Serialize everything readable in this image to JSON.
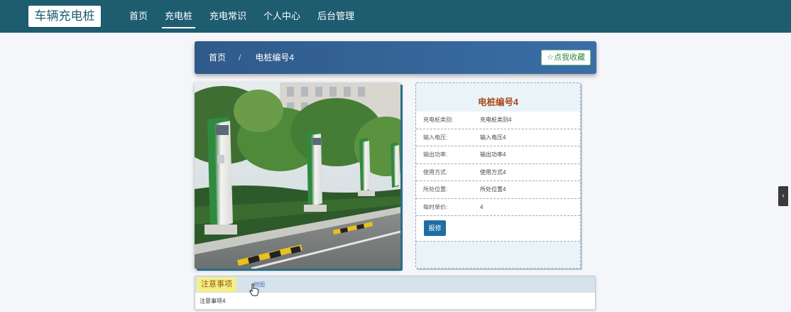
{
  "navbar": {
    "brand": "车辆充电桩",
    "items": [
      "首页",
      "充电桩",
      "充电常识",
      "个人中心",
      "后台管理"
    ],
    "active_index": 1
  },
  "breadcrumb": {
    "home": "首页",
    "separator": "/",
    "current": "电桩编号4"
  },
  "favorite_button": "☆点我收藏",
  "info": {
    "title": "电桩编号4",
    "rows": [
      {
        "label": "充电桩类别:",
        "value": "充电桩类别4"
      },
      {
        "label": "输入电压:",
        "value": "输入电压4"
      },
      {
        "label": "输出功率:",
        "value": "输出功率4"
      },
      {
        "label": "使用方式:",
        "value": "使用方式4"
      },
      {
        "label": "所处位置:",
        "value": "所处位置4"
      },
      {
        "label": "每时单价:",
        "value": "4"
      }
    ],
    "repair_button": "报修"
  },
  "notes": {
    "tab_notes": "注意事项",
    "tab_map": "地图",
    "content": "注意事项4"
  },
  "side_tab_icon": "chevron-left-icon",
  "colors": {
    "navbar": "#1e5c70",
    "breadcrumb_bar": "#2f5a8a",
    "info_title": "#a94a1a",
    "repair_button": "#1f6ea2",
    "notes_tab_highlight": "#f3f08a"
  }
}
